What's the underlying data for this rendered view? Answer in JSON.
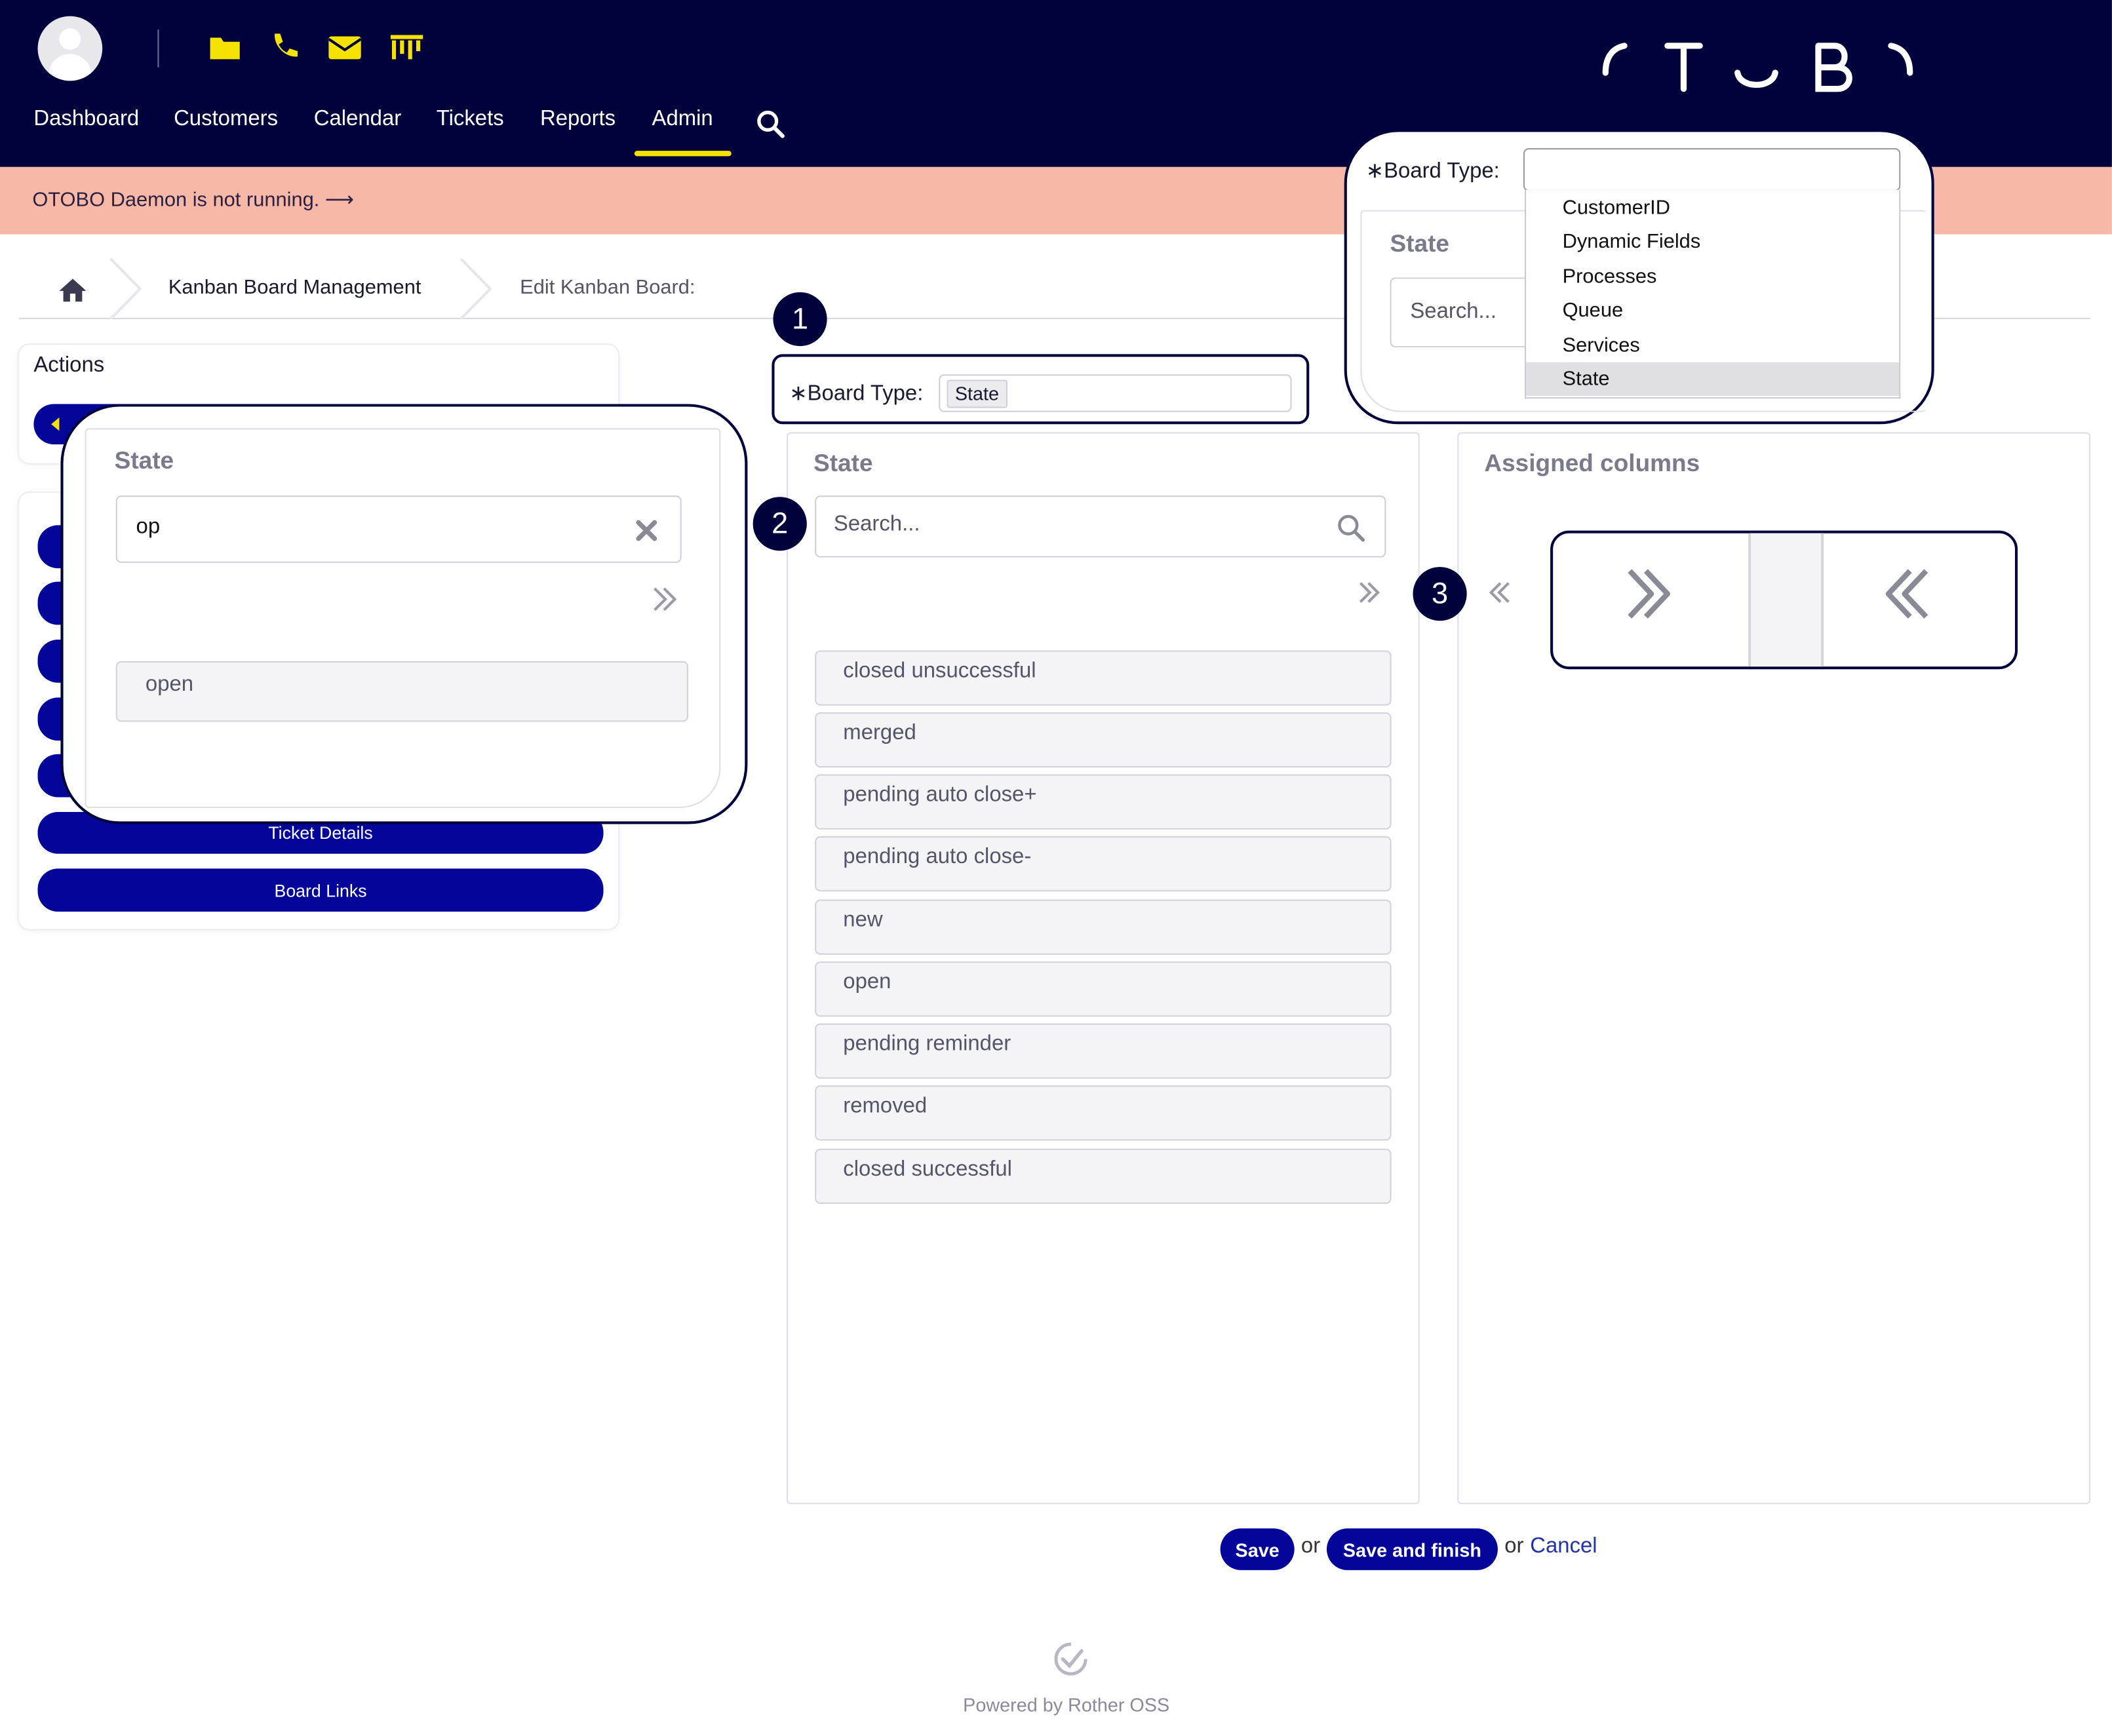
{
  "header": {
    "nav": [
      "Dashboard",
      "Customers",
      "Calendar",
      "Tickets",
      "Reports",
      "Admin"
    ],
    "active_nav": "Admin",
    "tool_icons": [
      "folder-icon",
      "phone-icon",
      "envelope-icon",
      "kanban-icon"
    ],
    "brand_logo": "OTOBO",
    "colors": {
      "background": "#00023c",
      "accent": "#f5e200"
    }
  },
  "notice": {
    "text": "OTOBO Daemon is not running.",
    "arrow": "⟶",
    "background": "#f8b8a8"
  },
  "breadcrumb": {
    "items": [
      "Kanban Board Management",
      "Edit Kanban Board:"
    ]
  },
  "sidebar": {
    "title": "Actions",
    "buttons": [
      "Ticket Details",
      "Board Links"
    ],
    "button_color": "#030699"
  },
  "form": {
    "board_type_label": "Board Type:",
    "required_mark": "∗",
    "board_type_value": "State"
  },
  "available": {
    "title": "State",
    "search_placeholder": "Search...",
    "items": [
      "closed unsuccessful",
      "merged",
      "pending auto close+",
      "pending auto close-",
      "new",
      "open",
      "pending reminder",
      "removed",
      "closed successful"
    ]
  },
  "assigned": {
    "title": "Assigned columns"
  },
  "callout_filter": {
    "title": "State",
    "query": "op",
    "result": "open"
  },
  "callout_dropdown": {
    "label": "Board Type:",
    "required_mark": "∗",
    "panel_title": "State",
    "search_placeholder": "Search...",
    "options": [
      "CustomerID",
      "Dynamic Fields",
      "Processes",
      "Queue",
      "Services",
      "State"
    ],
    "selected": "State"
  },
  "callout_numbers": [
    "1",
    "2",
    "3"
  ],
  "actions": {
    "save": "Save",
    "or": "or",
    "save_and_finish": "Save and finish",
    "cancel": "Cancel"
  },
  "footer": {
    "text": "Powered by Rother OSS"
  }
}
